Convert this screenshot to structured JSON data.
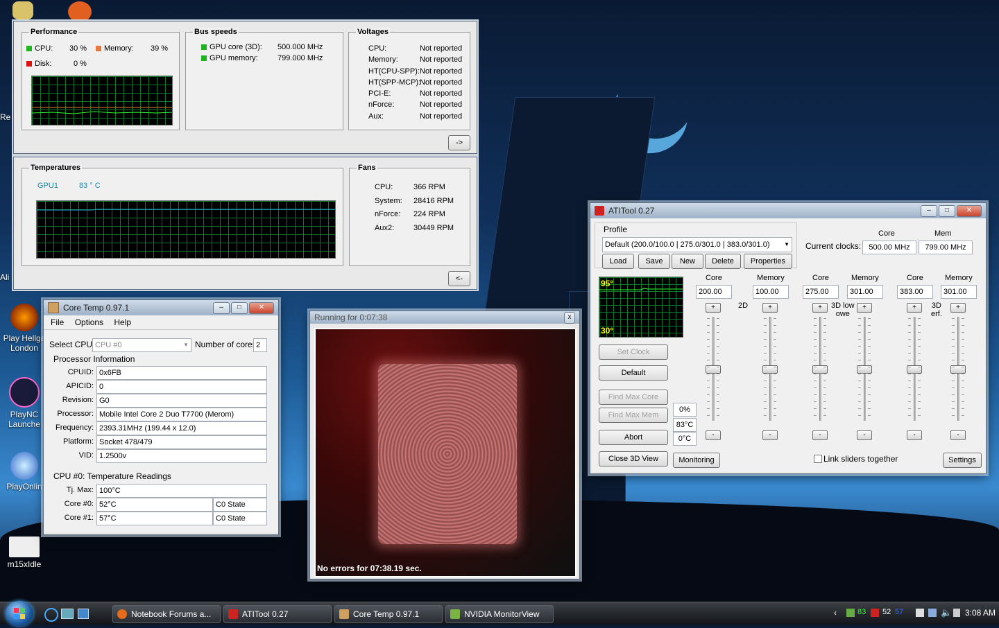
{
  "desktop": {
    "icons": [
      {
        "label": "Re",
        "color": "#c33"
      },
      {
        "label": "Ali",
        "color": "#777"
      },
      {
        "label": "Play Hellgate London",
        "color": "#b31"
      },
      {
        "label": "PlayNC Launcher",
        "color": "#246"
      },
      {
        "label": "PlayOnline",
        "color": "#36c"
      },
      {
        "label": "m15xIdle",
        "color": "#eee"
      }
    ],
    "icon_labels": {
      "hellgate_1": "Play Hellga",
      "hellgate_2": "London",
      "plaync_1": "PlayNC",
      "plaync_2": "Launche",
      "playonline": "PlayOnlin",
      "m15x": "m15xIdle",
      "re": "Re",
      "ali": "Ali"
    }
  },
  "nvidia": {
    "performance": {
      "title": "Performance",
      "cpu_label": "CPU:",
      "cpu_value": "30 %",
      "memory_label": "Memory:",
      "memory_value": "39 %",
      "disk_label": "Disk:",
      "disk_value": "0 %"
    },
    "bus": {
      "title": "Bus speeds",
      "gpu_core_label": "GPU core (3D):",
      "gpu_core_value": "500.000 MHz",
      "gpu_memory_label": "GPU memory:",
      "gpu_memory_value": "799.000 MHz"
    },
    "voltages": {
      "title": "Voltages",
      "rows": [
        {
          "label": "CPU:",
          "value": "Not reported"
        },
        {
          "label": "Memory:",
          "value": "Not reported"
        },
        {
          "label": "HT(CPU-SPP):",
          "value": "Not reported"
        },
        {
          "label": "HT(SPP-MCP):",
          "value": "Not reported"
        },
        {
          "label": "PCI-E:",
          "value": "Not reported"
        },
        {
          "label": "nForce:",
          "value": "Not reported"
        },
        {
          "label": "Aux:",
          "value": "Not reported"
        }
      ]
    },
    "expand_label": "->",
    "temperatures": {
      "title": "Temperatures",
      "gpu_label": "GPU1",
      "gpu_value": "83 ° C"
    },
    "fans": {
      "title": "Fans",
      "rows": [
        {
          "label": "CPU:",
          "value": "366 RPM"
        },
        {
          "label": "System:",
          "value": "28416 RPM"
        },
        {
          "label": "nForce:",
          "value": "224 RPM"
        },
        {
          "label": "Aux2:",
          "value": "30449 RPM"
        }
      ]
    },
    "collapse_label": "<-"
  },
  "coretemp": {
    "title": "Core Temp 0.97.1",
    "menu": [
      "File",
      "Options",
      "Help"
    ],
    "select_cpu_label": "Select CPU:",
    "select_cpu_value": "CPU #0",
    "num_cores_label": "Number of cores",
    "num_cores_value": "2",
    "proc_info_title": "Processor Information",
    "info": [
      {
        "label": "CPUID:",
        "value": "0x6FB"
      },
      {
        "label": "APICID:",
        "value": "0"
      },
      {
        "label": "Revision:",
        "value": "G0"
      },
      {
        "label": "Processor:",
        "value": "Mobile Intel Core 2 Duo T7700 (Merom)"
      },
      {
        "label": "Frequency:",
        "value": "2393.31MHz (199.44 x 12.0)"
      },
      {
        "label": "Platform:",
        "value": "Socket 478/479"
      },
      {
        "label": "VID:",
        "value": "1.2500v"
      }
    ],
    "temps_title": "CPU #0: Temperature Readings",
    "tjmax_label": "Tj. Max:",
    "tjmax_value": "100°C",
    "cores": [
      {
        "label": "Core #0:",
        "temp": "52°C",
        "state": "C0 State"
      },
      {
        "label": "Core #1:",
        "temp": "57°C",
        "state": "C0 State"
      }
    ]
  },
  "render": {
    "title": "Running for 0:07:38",
    "status": "No errors for 07:38.19 sec."
  },
  "atitool": {
    "title": "ATITool 0.27",
    "profile_label": "Profile",
    "profile_value": "Default (200.0/100.0 | 275.0/301.0 | 383.0/301.0)",
    "buttons": {
      "load": "Load",
      "save": "Save",
      "new": "New",
      "delete": "Delete",
      "properties": "Properties"
    },
    "current_clocks_label": "Current clocks:",
    "core_header": "Core",
    "mem_header": "Mem",
    "current_core": "500.00 MHz",
    "current_mem": "799.00 MHz",
    "graph_top": "95°",
    "graph_bottom": "30°",
    "left_buttons": {
      "set_clock": "Set Clock",
      "default": "Default",
      "find_max_core": "Find Max Core",
      "find_max_mem": "Find Max Mem",
      "abort": "Abort",
      "close_3d": "Close 3D View",
      "monitoring": "Monitoring"
    },
    "readouts": {
      "percent": "0%",
      "temp": "83°C",
      "temp2": "0°C"
    },
    "columns": [
      {
        "header": "Core",
        "value": "200.00",
        "level": 0.5
      },
      {
        "header": "Memory",
        "value": "100.00",
        "level": 0.5
      },
      {
        "header": "Core",
        "value": "275.00",
        "level": 0.5
      },
      {
        "header": "Memory",
        "value": "301.00",
        "level": 0.5
      },
      {
        "header": "Core",
        "value": "383.00",
        "level": 0.5
      },
      {
        "header": "Memory",
        "value": "301.00",
        "level": 0.5
      }
    ],
    "mode_labels": {
      "m2d": "2D",
      "m3dlow_1": "3D low",
      "m3dlow_2": "owe",
      "m3dperf_1": "3D",
      "m3dperf_2": "erf."
    },
    "plus": "+",
    "minus": "-",
    "link_sliders_label": "Link sliders together",
    "settings": "Settings"
  },
  "taskbar": {
    "tasks": [
      {
        "label": "Notebook Forums a...",
        "color": "#e66b1a"
      },
      {
        "label": "ATITool 0.27",
        "color": "#c22"
      },
      {
        "label": "Core Temp 0.97.1",
        "color": "#d0a060"
      },
      {
        "label": "NVIDIA MonitorView",
        "color": "#7ab440"
      }
    ],
    "tray_nums": [
      "83",
      "52",
      "57"
    ],
    "clock": "3:08 AM"
  }
}
